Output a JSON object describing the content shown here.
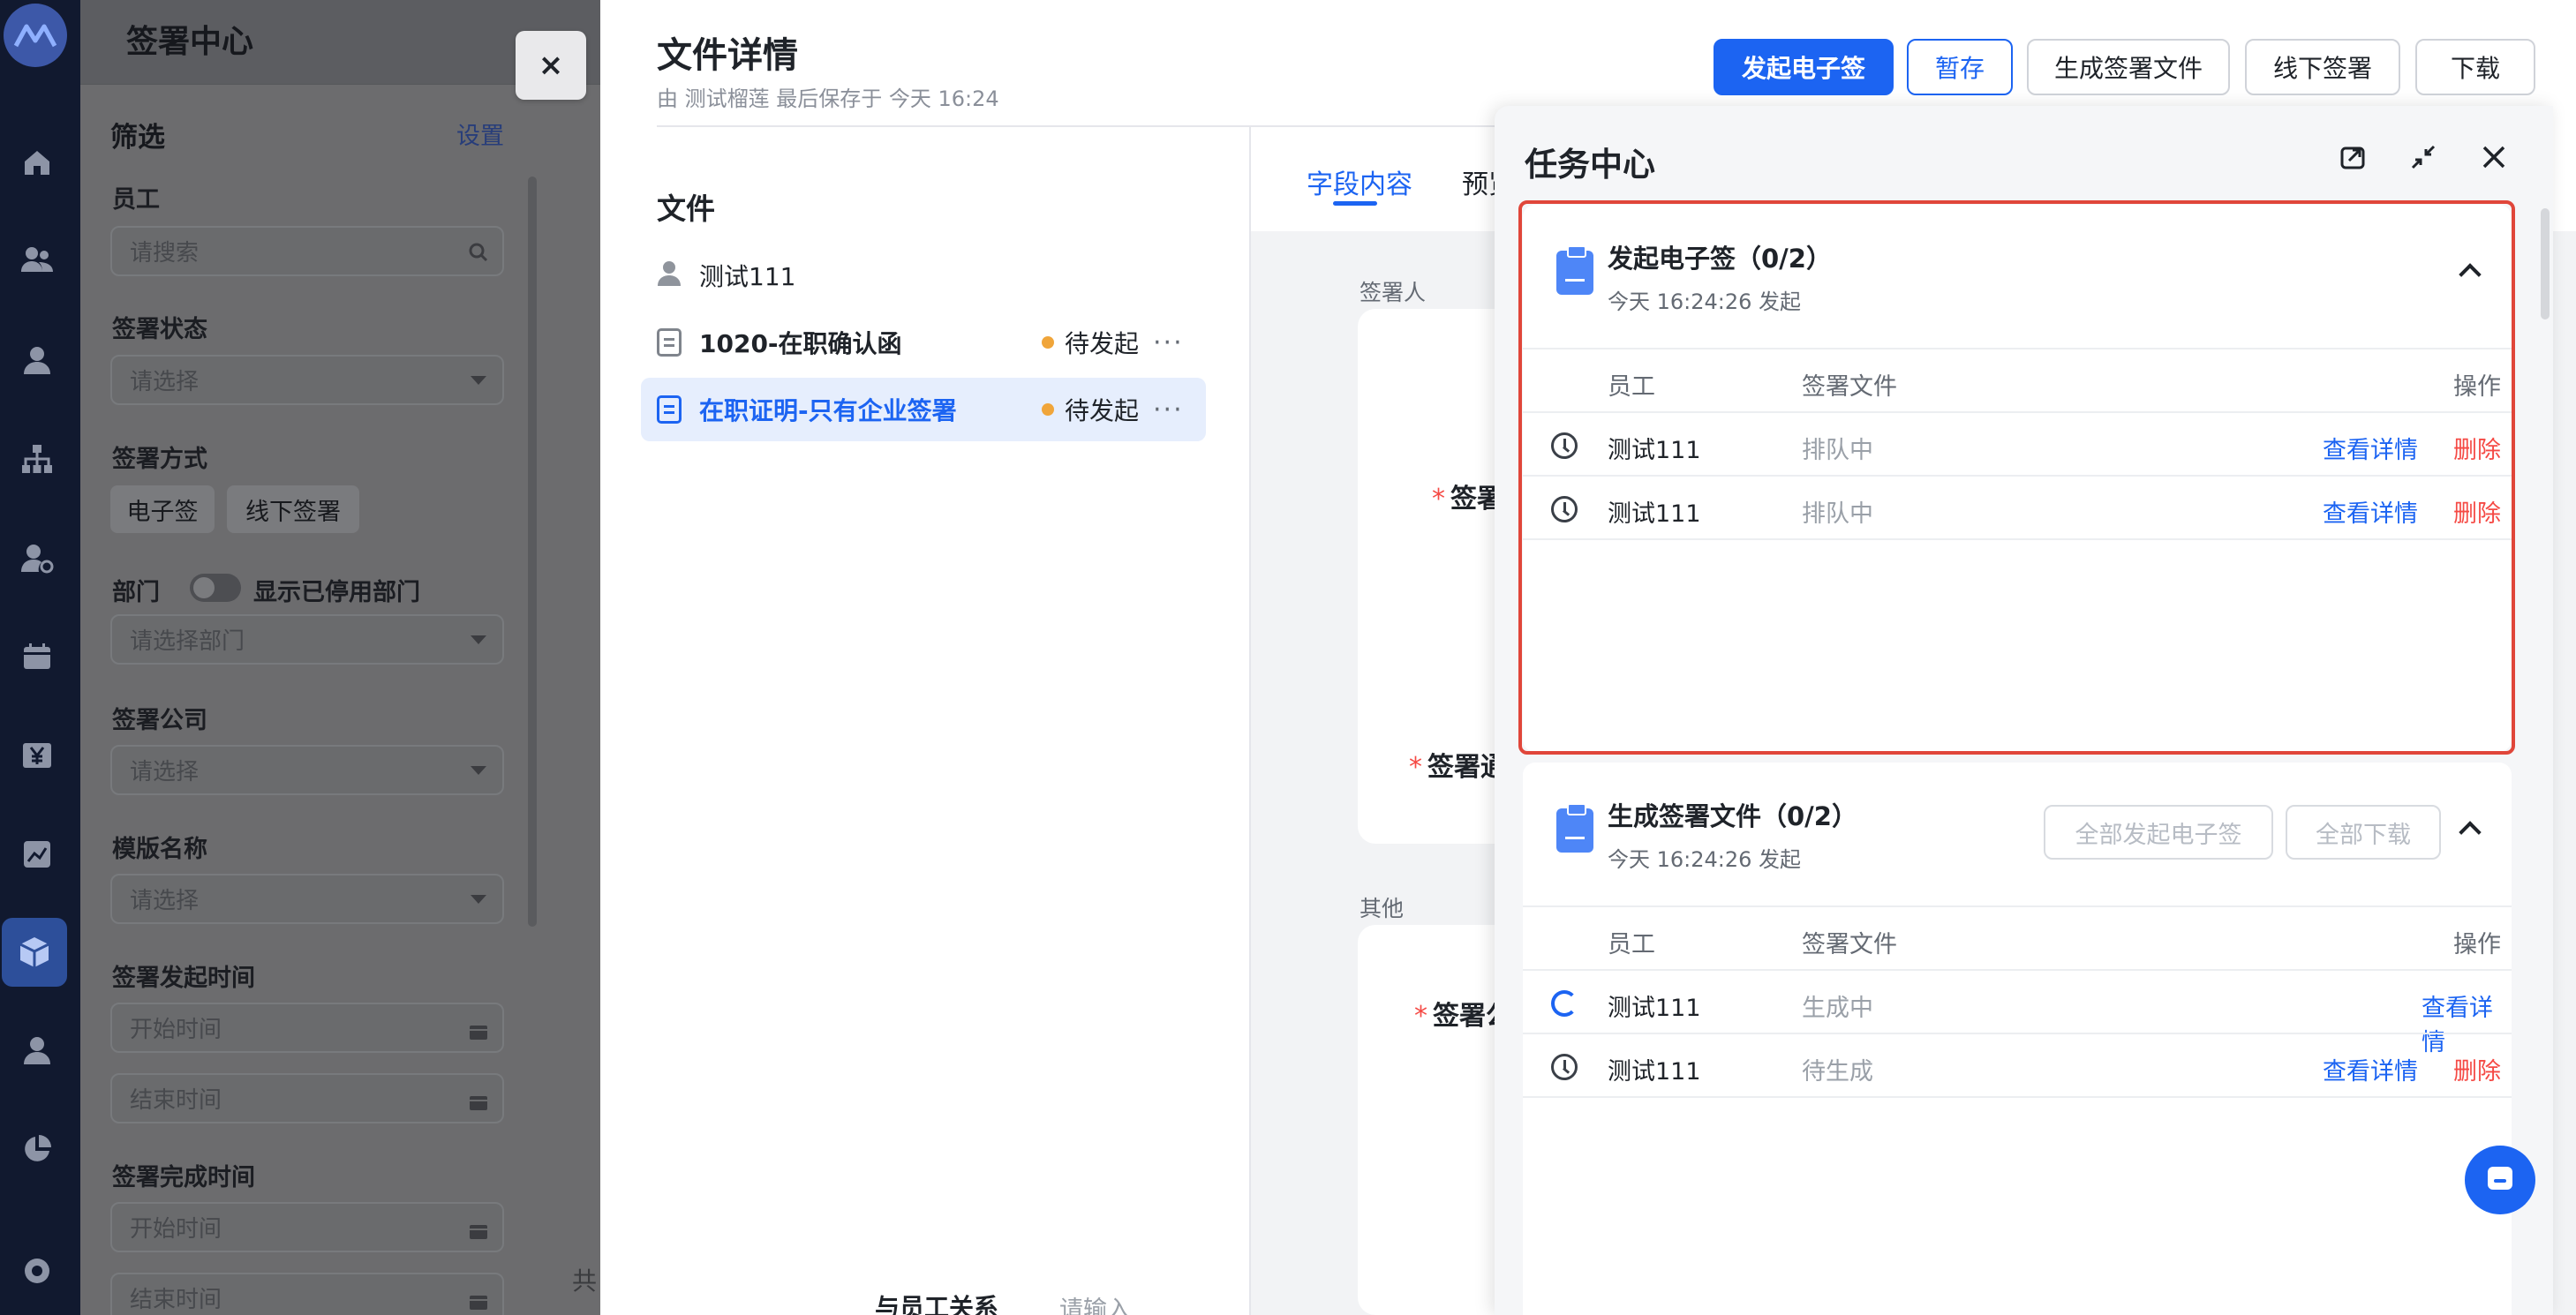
{
  "sidebar": {
    "title": "签署中心",
    "filter_title": "筛选",
    "settings_link": "设置",
    "employee_label": "员工",
    "employee_placeholder": "请搜索",
    "status_label": "签署状态",
    "status_placeholder": "请选择",
    "method_label": "签署方式",
    "method_options": [
      "电子签",
      "线下签署"
    ],
    "dept_label": "部门",
    "show_disabled_dept_label": "显示已停用部门",
    "dept_placeholder": "请选择部门",
    "company_label": "签署公司",
    "company_placeholder": "请选择",
    "template_label": "模版名称",
    "template_placeholder": "请选择",
    "start_time_label": "签署发起时间",
    "start_placeholder": "开始时间",
    "end_placeholder": "结束时间",
    "complete_time_label": "签署完成时间",
    "complete_start_placeholder": "开始时间",
    "complete_end_placeholder": "结束时间",
    "footer_text": "共"
  },
  "close_button": "×",
  "detail": {
    "title": "文件详情",
    "subtitle": "由 测试榴莲 最后保存于 今天 16:24",
    "buttons": {
      "start_esign": "发起电子签",
      "save_draft": "暂存",
      "generate": "生成签署文件",
      "offline": "线下签署",
      "download": "下载"
    },
    "files_heading": "文件",
    "person": "测试111",
    "files": [
      {
        "name": "1020-在职确认函",
        "status": "待发起",
        "more": "···"
      },
      {
        "name": "在职证明-只有企业签署",
        "status": "待发起",
        "more": "···"
      }
    ],
    "tabs": [
      "字段内容",
      "预览"
    ],
    "section_signer": "签署人",
    "section_other": "其他",
    "field_sign_a": "签署",
    "field_sign_b": "签署通",
    "field_sign_c": "签署公",
    "required_mark": "*",
    "bottom_label": "与员工关系",
    "bottom_placeholder": "请输入"
  },
  "task_center": {
    "title": "任务中心",
    "columns": {
      "employee": "员工",
      "file": "签署文件",
      "action": "操作"
    },
    "tasks": [
      {
        "title": "发起电子签（0/2）",
        "subtitle": "今天 16:24:26 发起",
        "rows": [
          {
            "employee": "测试111",
            "status": "排队中",
            "view": "查看详情",
            "delete": "删除"
          },
          {
            "employee": "测试111",
            "status": "排队中",
            "view": "查看详情",
            "delete": "删除"
          }
        ]
      },
      {
        "title": "生成签署文件（0/2）",
        "subtitle": "今天 16:24:26 发起",
        "batch_esign": "全部发起电子签",
        "batch_download": "全部下载",
        "rows": [
          {
            "employee": "测试111",
            "status": "生成中",
            "view": "查看详情",
            "delete": ""
          },
          {
            "employee": "测试111",
            "status": "待生成",
            "view": "查看详情",
            "delete": "删除"
          }
        ]
      }
    ]
  },
  "colors": {
    "primary": "#1c64f2",
    "danger": "#f54a45",
    "highlight": "#e0463a",
    "pending_dot": "#f0a53a"
  }
}
